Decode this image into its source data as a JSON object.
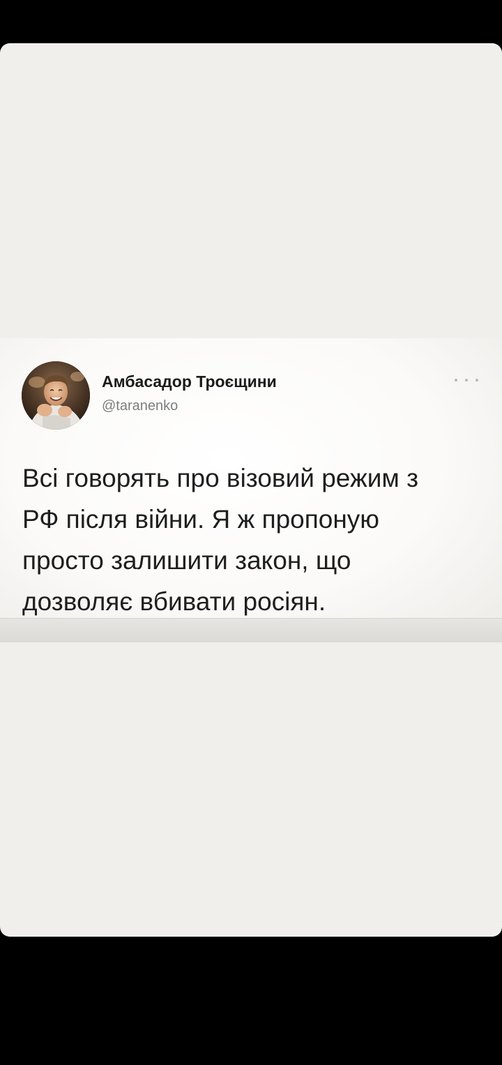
{
  "tweet": {
    "display_name": "Амбасадор Троєщини",
    "handle": "@taranenko",
    "text_lines": [
      "Всі говорять про візовий режим з",
      "РФ після війни. Я ж пропоную",
      "просто залишити закон, що",
      "дозволяє вбивати росіян."
    ],
    "more_icon": "ellipsis-icon"
  },
  "colors": {
    "outer_background": "#000000",
    "panel_background": "#f1efec",
    "name_color": "#1b1b1b",
    "handle_color": "#7d7d7d",
    "text_color": "#1e1e1e"
  }
}
